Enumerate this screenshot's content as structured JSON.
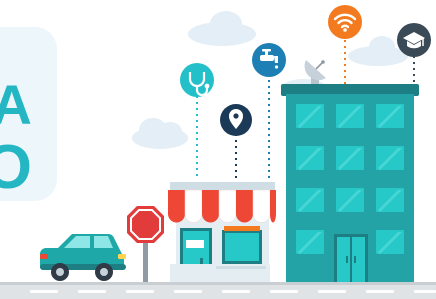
{
  "title_fragment": {
    "line1": "A",
    "line2": "O"
  },
  "icons": [
    {
      "name": "stethoscope-icon",
      "color": "#23c0c9"
    },
    {
      "name": "faucet-icon",
      "color": "#1d7fb3"
    },
    {
      "name": "wifi-icon",
      "color": "#f47a20"
    },
    {
      "name": "graduation-cap-icon",
      "color": "#3b4a57"
    },
    {
      "name": "location-pin-icon",
      "color": "#1b3a57"
    }
  ],
  "colors": {
    "building": "#24a3a6",
    "building_dark": "#1d7f83",
    "window": "#27c9c8",
    "awning_red": "#ee4736",
    "awning_white": "#ffffff",
    "car": "#1fa8a8",
    "stop_sign": "#e23b3b",
    "road": "#e0e3e6",
    "cloud": "#e3eef6"
  }
}
